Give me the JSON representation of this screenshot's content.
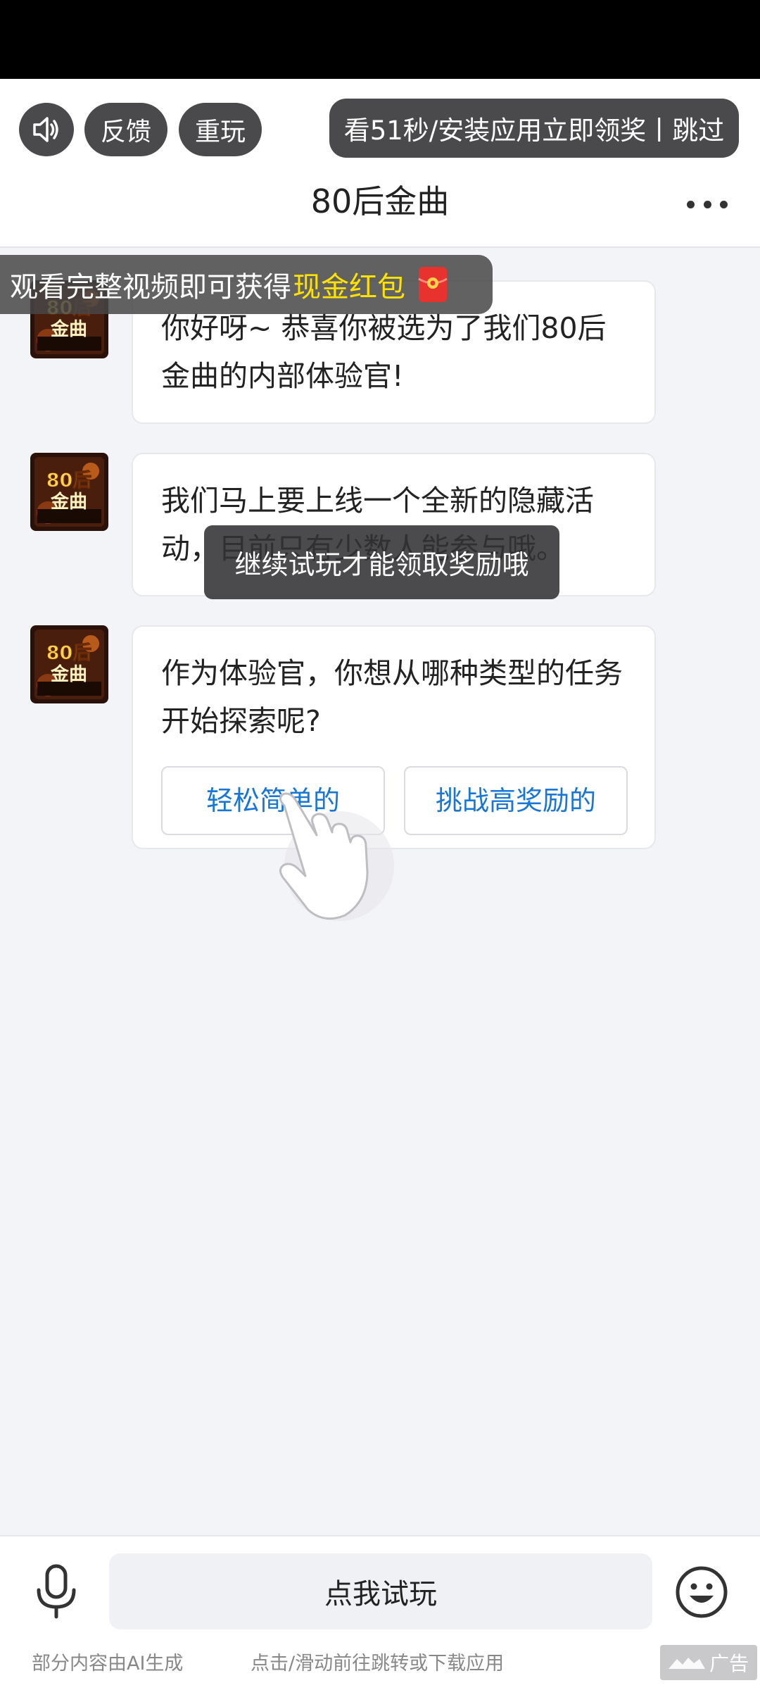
{
  "top_bar": {
    "feedback_label": "反馈",
    "replay_label": "重玩",
    "reward_label": "看51秒/安装应用立即领奖丨跳过"
  },
  "nav": {
    "title": "80后金曲"
  },
  "banner": {
    "text": "观看完整视频即可获得",
    "highlight": "现金红包"
  },
  "avatar": {
    "line1": "80后",
    "line2": "金曲"
  },
  "messages": [
    {
      "text": "你好呀~ 恭喜你被选为了我们80后金曲的内部体验官!"
    },
    {
      "text": "我们马上要上线一个全新的隐藏活动，目前只有少数人能参与哦。"
    },
    {
      "text": "作为体验官，你想从哪种类型的任务开始探索呢?"
    }
  ],
  "choices": [
    {
      "label": "轻松简单的"
    },
    {
      "label": "挑战高奖励的"
    }
  ],
  "toast": {
    "text": "继续试玩才能领取奖励哦"
  },
  "bottom": {
    "try_label": "点我试玩",
    "footer_left": "部分内容由AI生成",
    "footer_center": "点击/滑动前往跳转或下载应用",
    "ad_label": "广告"
  },
  "colors": {
    "highlight_yellow": "#ffe200",
    "link_blue": "#1877d6",
    "pill_dark": "#4a4a4c",
    "background": "#f3f4f8"
  }
}
